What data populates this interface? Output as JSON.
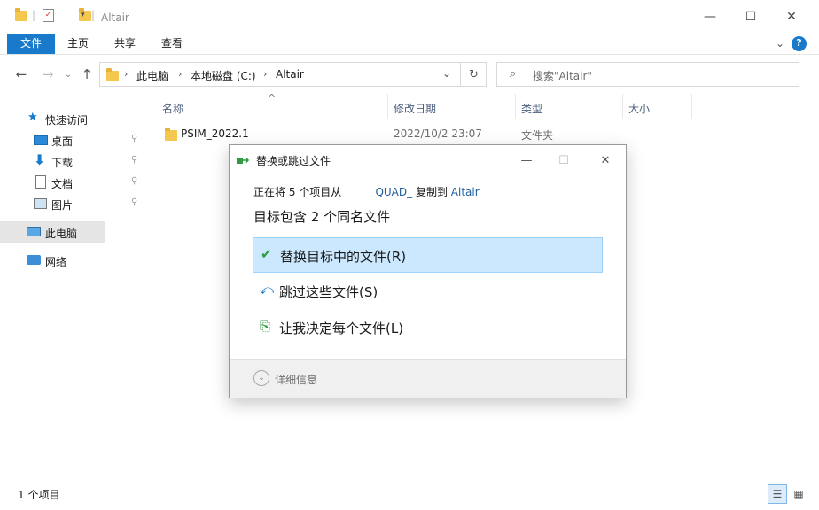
{
  "window": {
    "title": "Altair",
    "minimize": "—",
    "maximize": "☐",
    "close": "✕"
  },
  "ribbon": {
    "tabs": [
      "文件",
      "主页",
      "共享",
      "查看"
    ],
    "expand": "⌄",
    "help": "?"
  },
  "nav": {
    "back": "←",
    "forward": "→",
    "history": "⌄",
    "up": "↑",
    "breadcrumb": [
      "此电脑",
      "本地磁盘 (C:)",
      "Altair"
    ],
    "separator": "›",
    "dropdown": "⌄",
    "refresh": "↻",
    "search_placeholder": "搜索\"Altair\""
  },
  "sidebar": {
    "quick_access": "快速访问",
    "items": [
      "桌面",
      "下载",
      "文档",
      "图片"
    ],
    "this_pc": "此电脑",
    "network": "网络",
    "pin": "📌"
  },
  "content": {
    "sort_arrow": "^",
    "columns": [
      "名称",
      "修改日期",
      "类型",
      "大小"
    ],
    "rows": [
      {
        "name": "PSIM_2022.1",
        "date": "2022/10/2 23:07",
        "type": "文件夹"
      }
    ]
  },
  "status": {
    "count": "1 个项目"
  },
  "dialog": {
    "title": "替换或跳过文件",
    "minimize": "—",
    "maximize": "☐",
    "close": "✕",
    "line1_prefix": "正在将 5 个项目从",
    "line1_source": "QUAD_",
    "line1_middle": "复制到",
    "line1_dest": "Altair",
    "line2": "目标包含 2 个同名文件",
    "options": [
      {
        "icon": "✔",
        "label": "替换目标中的文件(R)"
      },
      {
        "icon": "⤺",
        "label": "跳过这些文件(S)"
      },
      {
        "icon": "⎘",
        "label": "让我决定每个文件(L)"
      }
    ],
    "details_icon": "⌄",
    "details": "详细信息"
  },
  "colors": {
    "accent": "#1979ca",
    "selected_option": "#cce8ff",
    "folder": "#f4c84e"
  }
}
